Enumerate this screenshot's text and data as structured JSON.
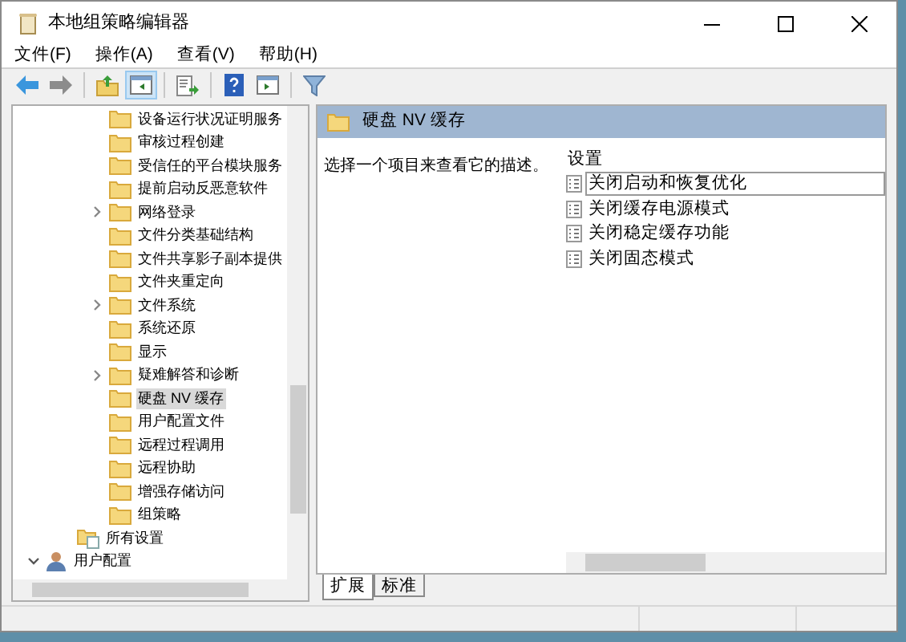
{
  "window": {
    "title": "本地组策略编辑器"
  },
  "menu": [
    "文件(F)",
    "操作(A)",
    "查看(V)",
    "帮助(H)"
  ],
  "toolbar": [
    {
      "kind": "back"
    },
    {
      "kind": "forward"
    },
    {
      "kind": "sep"
    },
    {
      "kind": "up"
    },
    {
      "kind": "tree",
      "selected": true
    },
    {
      "kind": "sep"
    },
    {
      "kind": "export"
    },
    {
      "kind": "sep"
    },
    {
      "kind": "help"
    },
    {
      "kind": "pane",
      "selected": false
    },
    {
      "kind": "sep"
    },
    {
      "kind": "filter"
    }
  ],
  "tree": [
    {
      "children": [
        {
          "children": [
            {
              "label": "设备运行状况证明服务",
              "selected": false
            },
            {
              "label": "审核过程创建",
              "selected": false
            },
            {
              "label": "受信任的平台模块服务",
              "selected": false
            },
            {
              "label": "提前启动反恶意软件",
              "selected": false
            },
            {
              "label": "网络登录",
              "selected": false,
              "expanded": false
            },
            {
              "label": "文件分类基础结构",
              "selected": false
            },
            {
              "label": "文件共享影子副本提供",
              "selected": false
            },
            {
              "label": "文件夹重定向",
              "selected": false
            },
            {
              "label": "文件系统",
              "selected": false,
              "expanded": false
            },
            {
              "label": "系统还原",
              "selected": false
            },
            {
              "label": "显示",
              "selected": false
            },
            {
              "label": "疑难解答和诊断",
              "selected": false,
              "expanded": false
            },
            {
              "label": "硬盘 NV 缓存",
              "selected": true
            },
            {
              "label": "用户配置文件",
              "selected": false
            },
            {
              "label": "远程过程调用",
              "selected": false
            },
            {
              "label": "远程协助",
              "selected": false
            },
            {
              "label": "增强存储访问",
              "selected": false
            },
            {
              "label": "组策略",
              "selected": false
            }
          ]
        },
        {
          "label": "所有设置",
          "kind": "settings",
          "selected": false
        }
      ]
    },
    {
      "label": "用户配置",
      "kind": "user",
      "selected": false,
      "expanded": true
    }
  ],
  "details": {
    "header": "硬盘 NV 缓存",
    "description": "选择一个项目来查看它的描述。",
    "column": "设置",
    "settings": [
      {
        "label": "关闭启动和恢复优化",
        "selected": true
      },
      {
        "label": "关闭缓存电源模式",
        "selected": false
      },
      {
        "label": "关闭稳定缓存功能",
        "selected": false
      },
      {
        "label": "关闭固态模式",
        "selected": false
      }
    ]
  },
  "tabs": [
    {
      "label": "扩展",
      "selected": true
    },
    {
      "label": "标准",
      "selected": false
    }
  ]
}
